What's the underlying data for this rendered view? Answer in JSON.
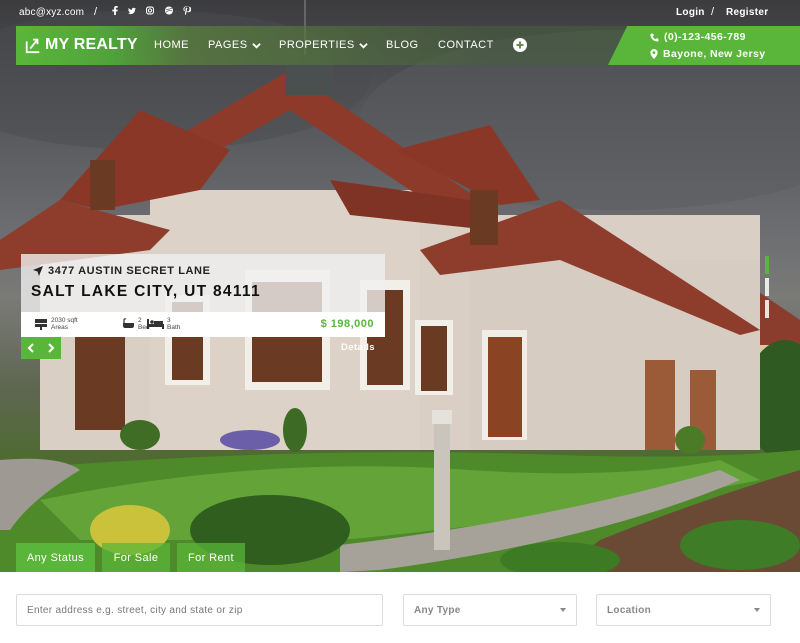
{
  "topbar": {
    "email": "abc@xyz.com",
    "separator": "/",
    "social_icons": [
      "facebook-icon",
      "twitter-icon",
      "instagram-icon",
      "dribbble-icon",
      "pinterest-icon"
    ],
    "login": "Login",
    "register": "Register"
  },
  "brand": {
    "name": "MY REALTY",
    "accent_color": "#5ab63a"
  },
  "nav": {
    "items": [
      {
        "label": "HOME",
        "has_dropdown": false
      },
      {
        "label": "PAGES",
        "has_dropdown": true
      },
      {
        "label": "PROPERTIES",
        "has_dropdown": true
      },
      {
        "label": "BLOG",
        "has_dropdown": false
      },
      {
        "label": "CONTACT",
        "has_dropdown": false
      }
    ],
    "extra_icon": "plus-circle-icon"
  },
  "contact": {
    "phone": "(0)-123-456-789",
    "location": "Bayone, New Jersy"
  },
  "listing": {
    "street": "3477 AUSTIN SECRET LANE",
    "city": "SALT LAKE CITY, UT 84111",
    "area_value": "2030 sqft",
    "area_label": "Areas",
    "beds_value": "2",
    "beds_label": "Bed",
    "baths_value": "3",
    "baths_label": "Bath",
    "price": "$ 198,000",
    "details": "Details"
  },
  "slider": {
    "count": 3,
    "active": 1
  },
  "search": {
    "tabs": [
      {
        "label": "Any Status",
        "active": true
      },
      {
        "label": "For Sale",
        "active": false
      },
      {
        "label": "For Rent",
        "active": false
      }
    ],
    "address_placeholder": "Enter address e.g. street, city and state or zip",
    "type_selected": "Any Type",
    "location_selected": "Location"
  }
}
